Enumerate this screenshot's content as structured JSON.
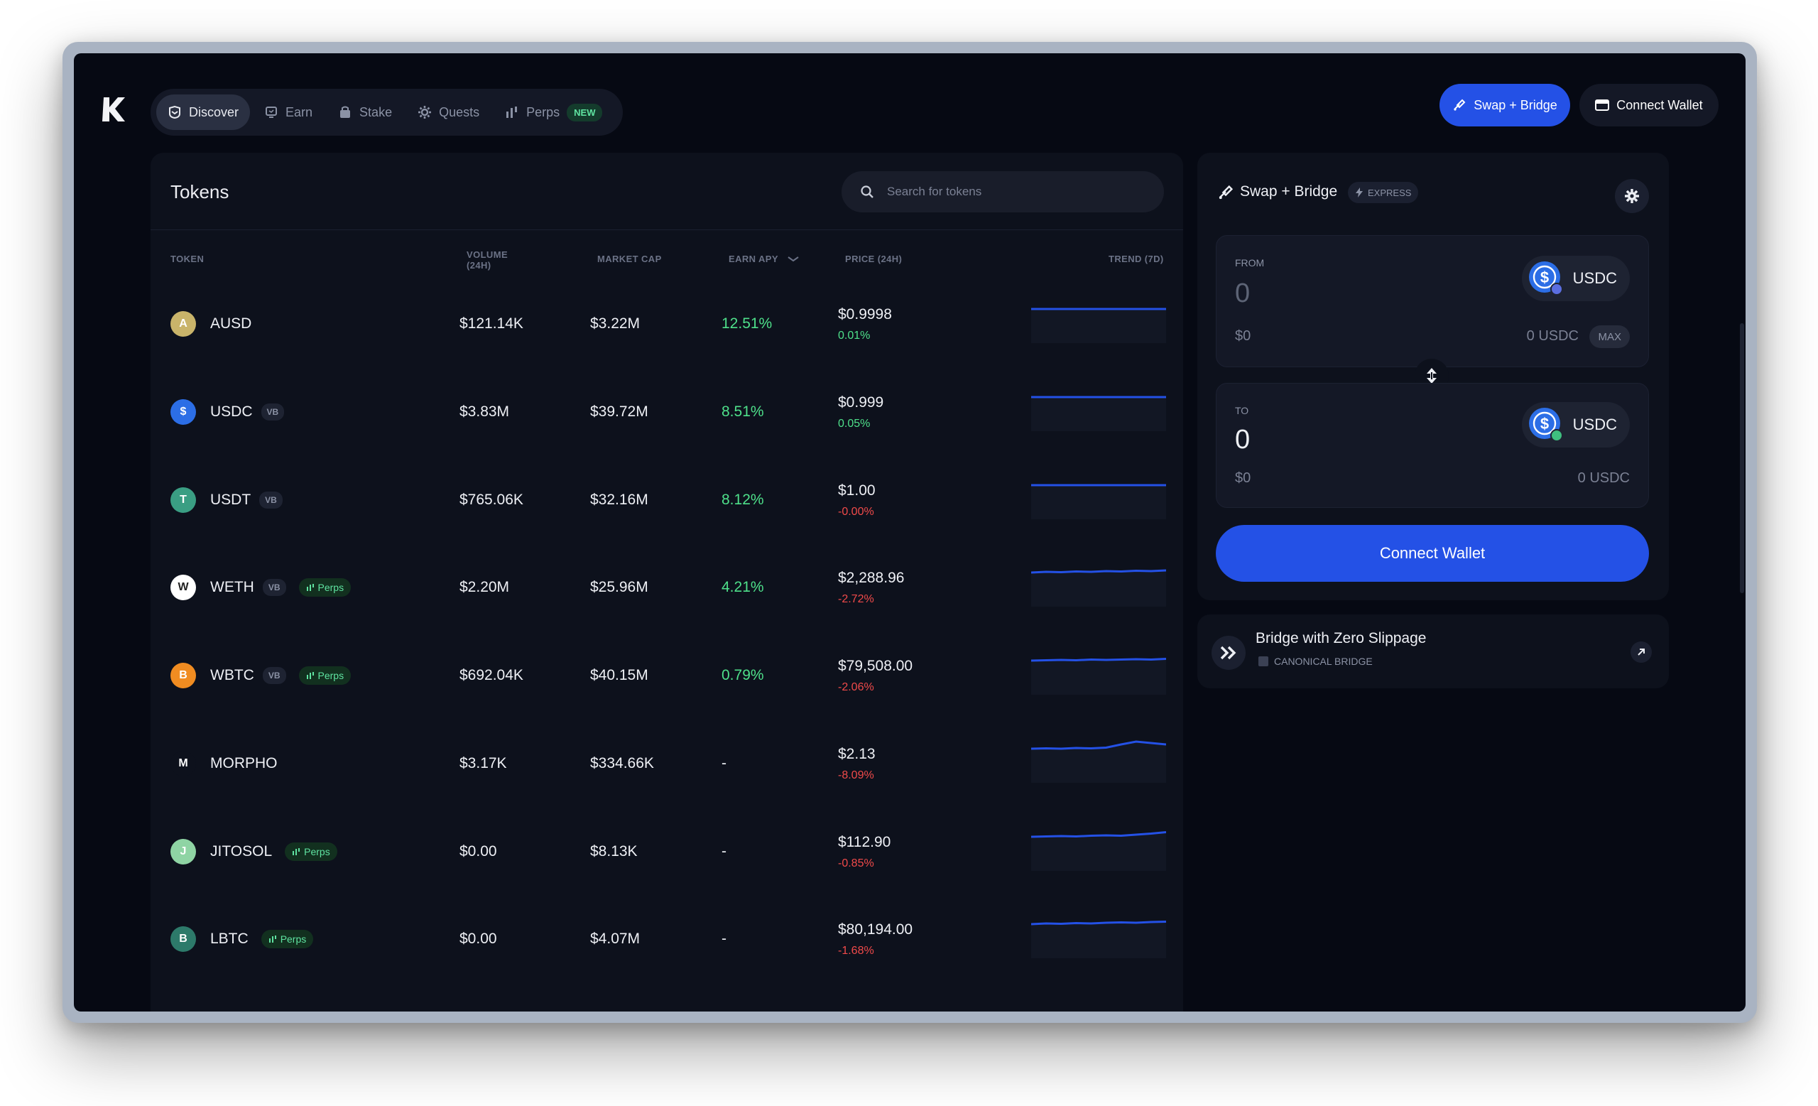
{
  "nav": {
    "items": [
      {
        "label": "Discover",
        "icon": "discover-icon"
      },
      {
        "label": "Earn",
        "icon": "earn-icon"
      },
      {
        "label": "Stake",
        "icon": "stake-icon"
      },
      {
        "label": "Quests",
        "icon": "quests-icon"
      },
      {
        "label": "Perps",
        "icon": "perps-icon",
        "badge": "NEW"
      }
    ]
  },
  "header": {
    "swap_label": "Swap + Bridge",
    "connect_label": "Connect Wallet"
  },
  "tokens": {
    "title": "Tokens",
    "search_placeholder": "Search for tokens",
    "columns": {
      "token": "TOKEN",
      "volume": "VOLUME",
      "volume_sub": "(24H)",
      "market_cap": "MARKET CAP",
      "earn_apy": "EARN APY",
      "price": "PRICE (24H)",
      "trend": "TREND (7D)"
    },
    "rows": [
      {
        "name": "AUSD",
        "vb": "",
        "perps": "",
        "volume": "$121.14K",
        "market_cap": "$3.22M",
        "apy": "12.51%",
        "price": "$0.9998",
        "change": "0.01%",
        "icon_color": "#c9b46a",
        "icon_glyph": "A"
      },
      {
        "name": "USDC",
        "vb": "VB",
        "perps": "",
        "volume": "$3.83M",
        "market_cap": "$39.72M",
        "apy": "8.51%",
        "price": "$0.999",
        "change": "0.05%",
        "icon_color": "#2c6ee6",
        "icon_glyph": "$"
      },
      {
        "name": "USDT",
        "vb": "VB",
        "perps": "",
        "volume": "$765.06K",
        "market_cap": "$32.16M",
        "apy": "8.12%",
        "price": "$1.00",
        "change": "-0.00%",
        "icon_color": "#3a9e83",
        "icon_glyph": "T"
      },
      {
        "name": "WETH",
        "vb": "VB",
        "perps": "Perps",
        "volume": "$2.20M",
        "market_cap": "$25.96M",
        "apy": "4.21%",
        "price": "$2,288.96",
        "change": "-2.72%",
        "icon_color": "#ffffff",
        "icon_glyph": "W"
      },
      {
        "name": "WBTC",
        "vb": "VB",
        "perps": "Perps",
        "volume": "$692.04K",
        "market_cap": "$40.15M",
        "apy": "0.79%",
        "price": "$79,508.00",
        "change": "-2.06%",
        "icon_color": "#f08c21",
        "icon_glyph": "B"
      },
      {
        "name": "MORPHO",
        "vb": "",
        "perps": "",
        "volume": "$3.17K",
        "market_cap": "$334.66K",
        "apy": "-",
        "price": "$2.13",
        "change": "-8.09%",
        "icon_color": "#0d111c",
        "icon_glyph": "M"
      },
      {
        "name": "JITOSOL",
        "vb": "",
        "perps": "Perps",
        "volume": "$0.00",
        "market_cap": "$8.13K",
        "apy": "-",
        "price": "$112.90",
        "change": "-0.85%",
        "icon_color": "#8fd4a4",
        "icon_glyph": "J"
      },
      {
        "name": "LBTC",
        "vb": "",
        "perps": "Perps",
        "volume": "$0.00",
        "market_cap": "$4.07M",
        "apy": "-",
        "price": "$80,194.00",
        "change": "-1.68%",
        "icon_color": "#2d7a6a",
        "icon_glyph": "B"
      }
    ]
  },
  "swap": {
    "title": "Swap + Bridge",
    "express_label": "EXPRESS",
    "from": {
      "label": "FROM",
      "amount": "0",
      "usd": "$0",
      "balance": "0 USDC",
      "token": "USDC",
      "max_label": "MAX"
    },
    "to": {
      "label": "TO",
      "amount": "0",
      "usd": "$0",
      "balance": "0 USDC",
      "token": "USDC"
    },
    "connect_label": "Connect Wallet"
  },
  "bridge": {
    "title": "Bridge with Zero Slippage",
    "subtitle": "CANONICAL BRIDGE"
  },
  "colors": {
    "accent": "#2451e6",
    "positive": "#4ee08a",
    "negative": "#f04a4a",
    "background": "#060913",
    "panel": "#0d111c"
  }
}
